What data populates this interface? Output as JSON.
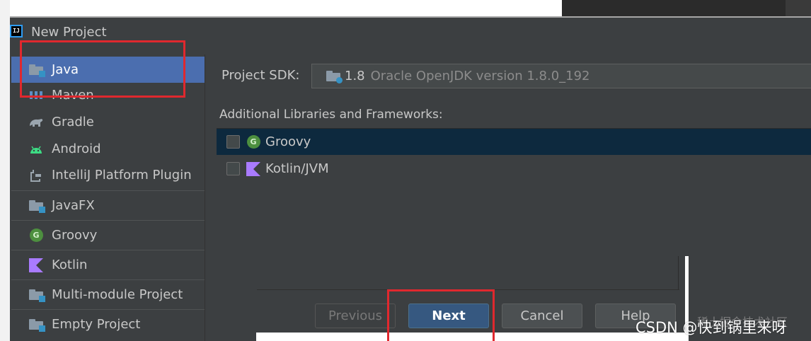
{
  "window": {
    "title": "New Project",
    "app_icon_text": "IJ"
  },
  "sidebar": {
    "items": [
      {
        "label": "Java",
        "icon": "folder-icon",
        "selected": true
      },
      {
        "label": "Maven",
        "icon": "maven-icon"
      },
      {
        "label": "Gradle",
        "icon": "gradle-icon"
      },
      {
        "label": "Android",
        "icon": "android-icon"
      },
      {
        "label": "IntelliJ Platform Plugin",
        "icon": "plugin-icon"
      },
      {
        "label": "JavaFX",
        "icon": "folder-icon"
      },
      {
        "label": "Groovy",
        "icon": "groovy-icon"
      },
      {
        "label": "Kotlin",
        "icon": "kotlin-icon"
      },
      {
        "label": "Multi-module Project",
        "icon": "folder-icon"
      },
      {
        "label": "Empty Project",
        "icon": "folder-icon"
      }
    ]
  },
  "main": {
    "sdk_label": "Project SDK:",
    "sdk_version": "1.8",
    "sdk_name": "Oracle OpenJDK version 1.8.0_192",
    "libs_label": "Additional Libraries and Frameworks:",
    "libraries": [
      {
        "label": "Groovy",
        "icon": "groovy-icon",
        "checked": false,
        "selected": true
      },
      {
        "label": "Kotlin/JVM",
        "icon": "kotlin-icon",
        "checked": false,
        "selected": false
      }
    ]
  },
  "buttons": {
    "previous": "Previous",
    "next": "Next",
    "cancel": "Cancel",
    "help": "Help"
  },
  "watermark": {
    "text": "CSDN @快到锅里来呀",
    "faint_text": "稀土掘金技术社区"
  },
  "colors": {
    "background": "#3c3f41",
    "selection": "#4b6eaf",
    "list_selection": "#0d293e",
    "default_button": "#365880",
    "annotation_red": "#e0282e"
  }
}
